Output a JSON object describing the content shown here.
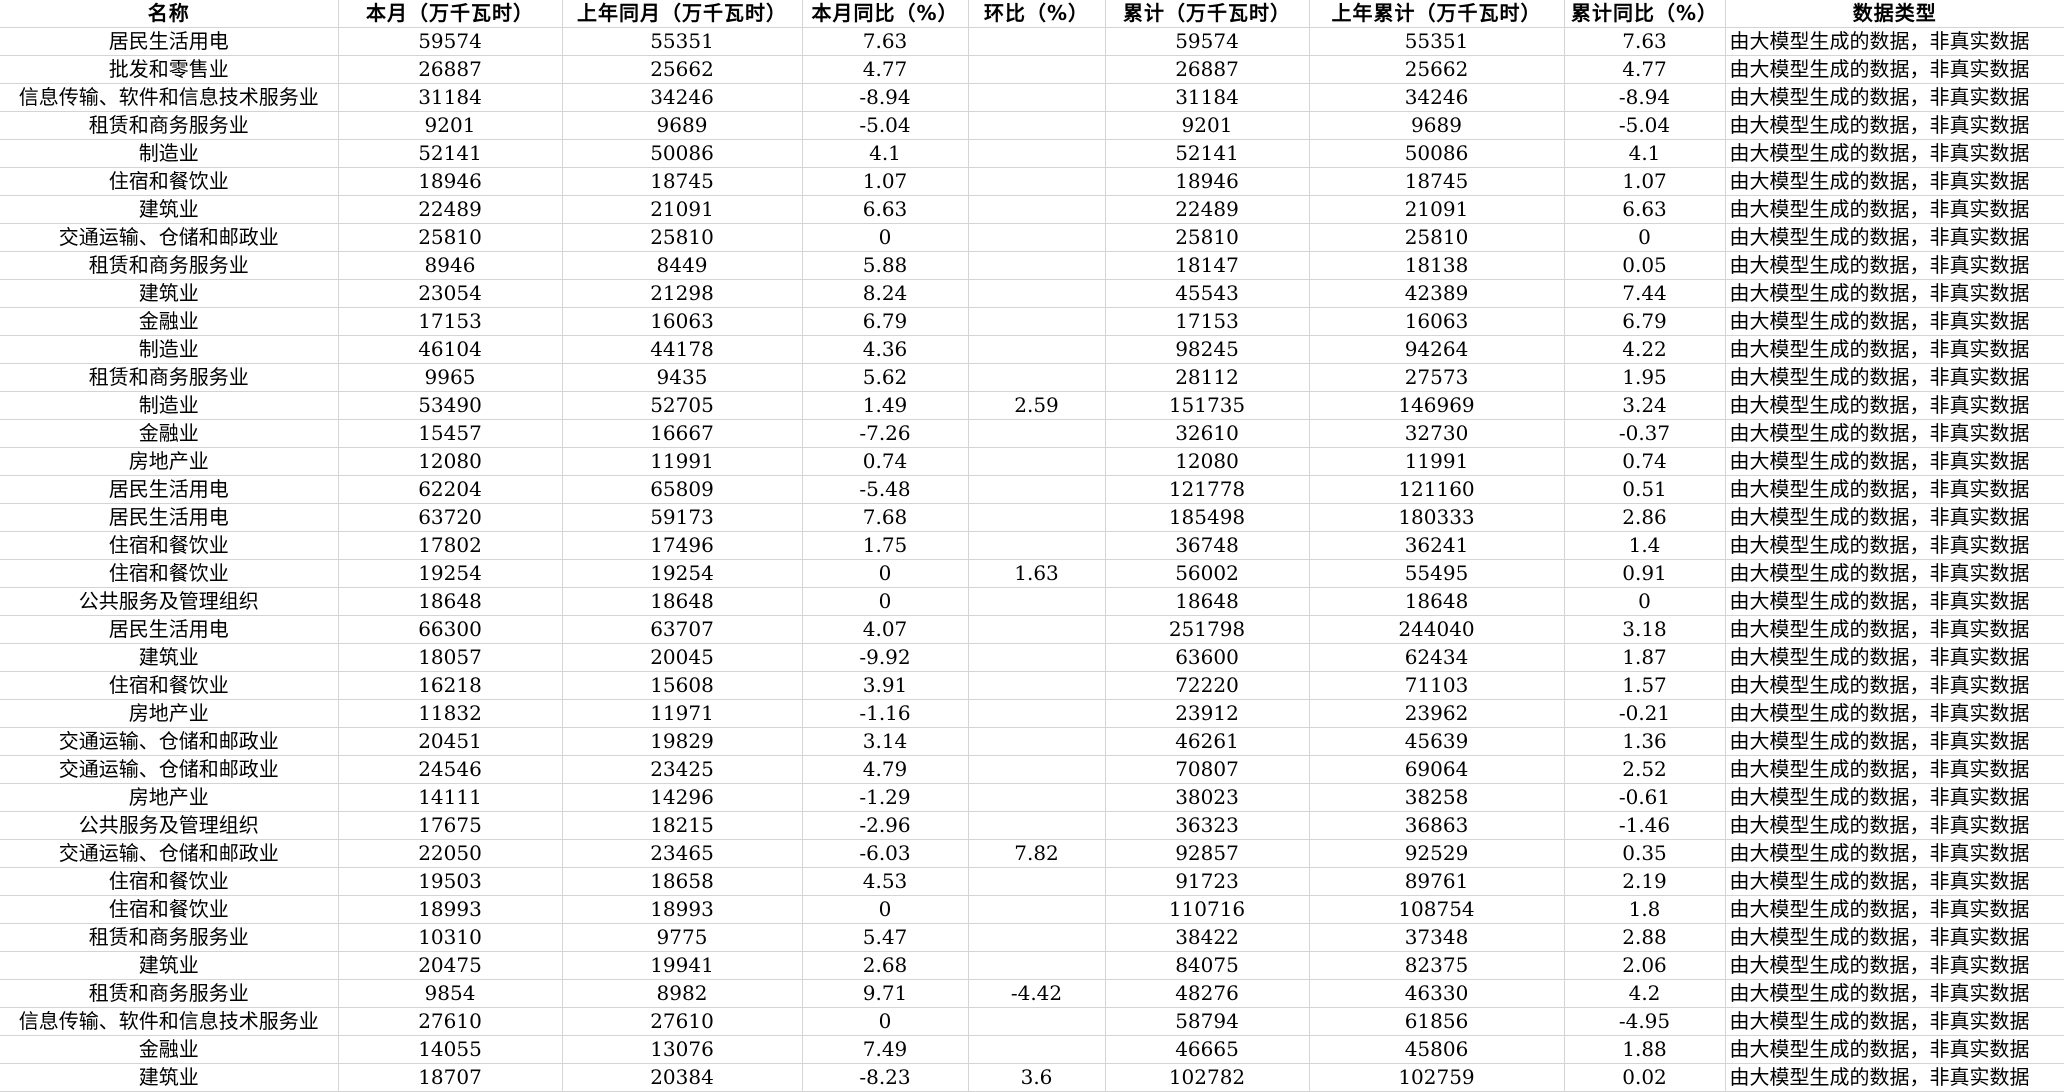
{
  "headers": [
    "名称",
    "本月（万千瓦时）",
    "上年同月（万千瓦时）",
    "本月同比（%）",
    "环比（%）",
    "累计（万千瓦时）",
    "上年累计（万千瓦时）",
    "累计同比（%）",
    "数据类型"
  ],
  "rows": [
    [
      "居民生活用电",
      "59574",
      "55351",
      "7.63",
      "",
      "59574",
      "55351",
      "7.63",
      "由大模型生成的数据，非真实数据"
    ],
    [
      "批发和零售业",
      "26887",
      "25662",
      "4.77",
      "",
      "26887",
      "25662",
      "4.77",
      "由大模型生成的数据，非真实数据"
    ],
    [
      "信息传输、软件和信息技术服务业",
      "31184",
      "34246",
      "-8.94",
      "",
      "31184",
      "34246",
      "-8.94",
      "由大模型生成的数据，非真实数据"
    ],
    [
      "租赁和商务服务业",
      "9201",
      "9689",
      "-5.04",
      "",
      "9201",
      "9689",
      "-5.04",
      "由大模型生成的数据，非真实数据"
    ],
    [
      "制造业",
      "52141",
      "50086",
      "4.1",
      "",
      "52141",
      "50086",
      "4.1",
      "由大模型生成的数据，非真实数据"
    ],
    [
      "住宿和餐饮业",
      "18946",
      "18745",
      "1.07",
      "",
      "18946",
      "18745",
      "1.07",
      "由大模型生成的数据，非真实数据"
    ],
    [
      "建筑业",
      "22489",
      "21091",
      "6.63",
      "",
      "22489",
      "21091",
      "6.63",
      "由大模型生成的数据，非真实数据"
    ],
    [
      "交通运输、仓储和邮政业",
      "25810",
      "25810",
      "0",
      "",
      "25810",
      "25810",
      "0",
      "由大模型生成的数据，非真实数据"
    ],
    [
      "租赁和商务服务业",
      "8946",
      "8449",
      "5.88",
      "",
      "18147",
      "18138",
      "0.05",
      "由大模型生成的数据，非真实数据"
    ],
    [
      "建筑业",
      "23054",
      "21298",
      "8.24",
      "",
      "45543",
      "42389",
      "7.44",
      "由大模型生成的数据，非真实数据"
    ],
    [
      "金融业",
      "17153",
      "16063",
      "6.79",
      "",
      "17153",
      "16063",
      "6.79",
      "由大模型生成的数据，非真实数据"
    ],
    [
      "制造业",
      "46104",
      "44178",
      "4.36",
      "",
      "98245",
      "94264",
      "4.22",
      "由大模型生成的数据，非真实数据"
    ],
    [
      "租赁和商务服务业",
      "9965",
      "9435",
      "5.62",
      "",
      "28112",
      "27573",
      "1.95",
      "由大模型生成的数据，非真实数据"
    ],
    [
      "制造业",
      "53490",
      "52705",
      "1.49",
      "2.59",
      "151735",
      "146969",
      "3.24",
      "由大模型生成的数据，非真实数据"
    ],
    [
      "金融业",
      "15457",
      "16667",
      "-7.26",
      "",
      "32610",
      "32730",
      "-0.37",
      "由大模型生成的数据，非真实数据"
    ],
    [
      "房地产业",
      "12080",
      "11991",
      "0.74",
      "",
      "12080",
      "11991",
      "0.74",
      "由大模型生成的数据，非真实数据"
    ],
    [
      "居民生活用电",
      "62204",
      "65809",
      "-5.48",
      "",
      "121778",
      "121160",
      "0.51",
      "由大模型生成的数据，非真实数据"
    ],
    [
      "居民生活用电",
      "63720",
      "59173",
      "7.68",
      "",
      "185498",
      "180333",
      "2.86",
      "由大模型生成的数据，非真实数据"
    ],
    [
      "住宿和餐饮业",
      "17802",
      "17496",
      "1.75",
      "",
      "36748",
      "36241",
      "1.4",
      "由大模型生成的数据，非真实数据"
    ],
    [
      "住宿和餐饮业",
      "19254",
      "19254",
      "0",
      "1.63",
      "56002",
      "55495",
      "0.91",
      "由大模型生成的数据，非真实数据"
    ],
    [
      "公共服务及管理组织",
      "18648",
      "18648",
      "0",
      "",
      "18648",
      "18648",
      "0",
      "由大模型生成的数据，非真实数据"
    ],
    [
      "居民生活用电",
      "66300",
      "63707",
      "4.07",
      "",
      "251798",
      "244040",
      "3.18",
      "由大模型生成的数据，非真实数据"
    ],
    [
      "建筑业",
      "18057",
      "20045",
      "-9.92",
      "",
      "63600",
      "62434",
      "1.87",
      "由大模型生成的数据，非真实数据"
    ],
    [
      "住宿和餐饮业",
      "16218",
      "15608",
      "3.91",
      "",
      "72220",
      "71103",
      "1.57",
      "由大模型生成的数据，非真实数据"
    ],
    [
      "房地产业",
      "11832",
      "11971",
      "-1.16",
      "",
      "23912",
      "23962",
      "-0.21",
      "由大模型生成的数据，非真实数据"
    ],
    [
      "交通运输、仓储和邮政业",
      "20451",
      "19829",
      "3.14",
      "",
      "46261",
      "45639",
      "1.36",
      "由大模型生成的数据，非真实数据"
    ],
    [
      "交通运输、仓储和邮政业",
      "24546",
      "23425",
      "4.79",
      "",
      "70807",
      "69064",
      "2.52",
      "由大模型生成的数据，非真实数据"
    ],
    [
      "房地产业",
      "14111",
      "14296",
      "-1.29",
      "",
      "38023",
      "38258",
      "-0.61",
      "由大模型生成的数据，非真实数据"
    ],
    [
      "公共服务及管理组织",
      "17675",
      "18215",
      "-2.96",
      "",
      "36323",
      "36863",
      "-1.46",
      "由大模型生成的数据，非真实数据"
    ],
    [
      "交通运输、仓储和邮政业",
      "22050",
      "23465",
      "-6.03",
      "7.82",
      "92857",
      "92529",
      "0.35",
      "由大模型生成的数据，非真实数据"
    ],
    [
      "住宿和餐饮业",
      "19503",
      "18658",
      "4.53",
      "",
      "91723",
      "89761",
      "2.19",
      "由大模型生成的数据，非真实数据"
    ],
    [
      "住宿和餐饮业",
      "18993",
      "18993",
      "0",
      "",
      "110716",
      "108754",
      "1.8",
      "由大模型生成的数据，非真实数据"
    ],
    [
      "租赁和商务服务业",
      "10310",
      "9775",
      "5.47",
      "",
      "38422",
      "37348",
      "2.88",
      "由大模型生成的数据，非真实数据"
    ],
    [
      "建筑业",
      "20475",
      "19941",
      "2.68",
      "",
      "84075",
      "82375",
      "2.06",
      "由大模型生成的数据，非真实数据"
    ],
    [
      "租赁和商务服务业",
      "9854",
      "8982",
      "9.71",
      "-4.42",
      "48276",
      "46330",
      "4.2",
      "由大模型生成的数据，非真实数据"
    ],
    [
      "信息传输、软件和信息技术服务业",
      "27610",
      "27610",
      "0",
      "",
      "58794",
      "61856",
      "-4.95",
      "由大模型生成的数据，非真实数据"
    ],
    [
      "金融业",
      "14055",
      "13076",
      "7.49",
      "",
      "46665",
      "45806",
      "1.88",
      "由大模型生成的数据，非真实数据"
    ],
    [
      "建筑业",
      "18707",
      "20384",
      "-8.23",
      "3.6",
      "102782",
      "102759",
      "0.02",
      "由大模型生成的数据，非真实数据"
    ]
  ]
}
